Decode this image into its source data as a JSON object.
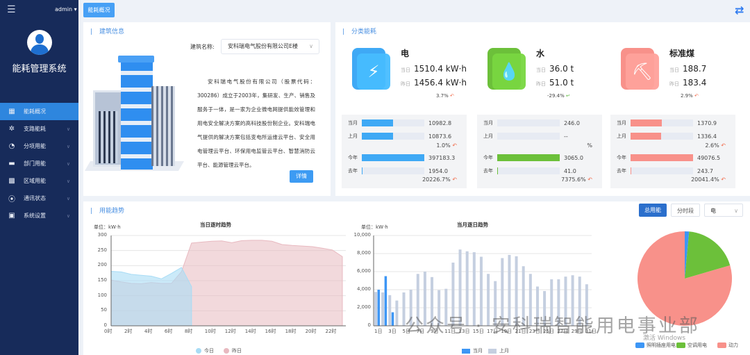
{
  "sidebar": {
    "user": "admin",
    "system_name": "能耗管理系统",
    "items": [
      {
        "label": "能耗概况",
        "icon": "building-icon"
      },
      {
        "label": "支路能耗",
        "icon": "network-icon"
      },
      {
        "label": "分项用能",
        "icon": "gauge-icon"
      },
      {
        "label": "部门用能",
        "icon": "folder-icon"
      },
      {
        "label": "区域用能",
        "icon": "grid-building-icon"
      },
      {
        "label": "通讯状态",
        "icon": "location-icon"
      },
      {
        "label": "系统设置",
        "icon": "settings-monitor-icon"
      }
    ]
  },
  "tabs": {
    "active": "能耗概况"
  },
  "building": {
    "title": "建筑信息",
    "select_label": "建筑名称:",
    "select_value": "安科瑞电气股份有限公司E楼",
    "description": "安科瑞电气股份有限公司（股票代码：300286）成立于2003年，集研发、生产、销售及服务于一体，是一家为企业微电网提供能效管理和用电安全解决方案的高科技股份制企业。安科瑞电气提供的解决方案包括变电所运维云平台、安全用电管理云平台、环保用电监管云平台、智慧消防云平台、能源管理云平台。",
    "detail_button": "详情"
  },
  "category": {
    "title": "分类能耗",
    "today_label": "当日",
    "yesterday_label": "昨日",
    "cards": [
      {
        "name": "电",
        "today": "1510.4 kW·h",
        "yesterday": "1456.4 kW·h",
        "change": "3.7%",
        "trend": "up",
        "color": "#3fa9f5",
        "month": {
          "cur_label": "当月",
          "cur": "10982.8",
          "cur_frac": 0.5,
          "prev_label": "上月",
          "prev": "10873.6",
          "prev_frac": 0.5,
          "change": "1.0%"
        },
        "year": {
          "cur_label": "今年",
          "cur": "397183.3",
          "cur_frac": 1.0,
          "prev_label": "去年",
          "prev": "1954.0",
          "prev_frac": 0.01,
          "change": "20226.7%"
        }
      },
      {
        "name": "水",
        "today": "36.0 t",
        "yesterday": "51.0 t",
        "change": "-29.4%",
        "trend": "down",
        "color": "#6cc03a",
        "month": {
          "cur_label": "当月",
          "cur": "246.0",
          "cur_frac": 0,
          "prev_label": "上月",
          "prev": "--",
          "prev_frac": 0,
          "change": "%"
        },
        "year": {
          "cur_label": "今年",
          "cur": "3065.0",
          "cur_frac": 1.0,
          "prev_label": "去年",
          "prev": "41.0",
          "prev_frac": 0.013,
          "change": "7375.6%"
        }
      },
      {
        "name": "标准煤",
        "today": "188.7",
        "yesterday": "183.4",
        "change": "2.9%",
        "trend": "up",
        "color": "#f8918a",
        "month": {
          "cur_label": "当月",
          "cur": "1370.9",
          "cur_frac": 0.5,
          "prev_label": "上月",
          "prev": "1336.4",
          "prev_frac": 0.49,
          "change": "2.6%"
        },
        "year": {
          "cur_label": "今年",
          "cur": "49076.5",
          "cur_frac": 1.0,
          "prev_label": "去年",
          "prev": "243.7",
          "prev_frac": 0.005,
          "change": "20041.4%"
        }
      }
    ]
  },
  "trend": {
    "title": "用能趋势",
    "buttons": [
      "总用能",
      "分时段"
    ],
    "energy_select": "电"
  },
  "chart_data": [
    {
      "type": "area",
      "title": "当日逐时趋势",
      "unit": "单位：kW·h",
      "ylim": [
        0,
        300
      ],
      "yticks": [
        0,
        50,
        100,
        150,
        200,
        250,
        300
      ],
      "x": [
        0,
        1,
        2,
        3,
        4,
        5,
        6,
        7,
        8,
        9,
        10,
        11,
        12,
        13,
        14,
        15,
        16,
        17,
        18,
        19,
        20,
        21,
        22,
        23
      ],
      "xticks": [
        "0时",
        "2时",
        "4时",
        "6时",
        "8时",
        "10时",
        "12时",
        "14时",
        "16时",
        "18时",
        "20时",
        "22时"
      ],
      "series": [
        {
          "name": "今日",
          "color": "#a8dcf5",
          "values": [
            181,
            179,
            171,
            168,
            165,
            156,
            174,
            194,
            130
          ]
        },
        {
          "name": "昨日",
          "color": "#e8b9c0",
          "values": [
            152,
            146,
            141,
            140,
            144,
            141,
            141,
            180,
            275,
            278,
            281,
            282,
            276,
            283,
            284,
            284,
            281,
            270,
            267,
            265,
            263,
            258,
            252,
            230
          ]
        }
      ]
    },
    {
      "type": "bar",
      "title": "当月逐日趋势",
      "unit": "单位：kW·h",
      "ylim": [
        0,
        10000
      ],
      "yticks": [
        "0",
        "2,000",
        "4,000",
        "6,000",
        "8,000",
        "10,000"
      ],
      "xticks": [
        "1日",
        "3日",
        "5日",
        "7日",
        "9日",
        "11日",
        "13日",
        "15日",
        "17日",
        "19日",
        "21日",
        "23日",
        "25日",
        "27日",
        "29日",
        "31日"
      ],
      "series": [
        {
          "name": "当月",
          "color": "#3d96f5",
          "values": [
            4000,
            5500,
            1500
          ]
        },
        {
          "name": "上月",
          "color": "#c5cfe0",
          "values": [
            3750,
            3700,
            3400,
            2800,
            3700,
            4000,
            5750,
            6000,
            5400,
            3950,
            4100,
            7000,
            8450,
            8250,
            8150,
            7650,
            5750,
            4950,
            7500,
            7850,
            7700,
            6600,
            5750,
            4350,
            3850,
            5150,
            5150,
            5450,
            5600,
            5450,
            4600
          ]
        }
      ]
    },
    {
      "type": "pie",
      "labels": [
        "照明插座用电",
        "空调用电",
        "动力"
      ],
      "values": [
        1.5,
        19,
        79.5
      ],
      "colors": [
        "#3d96f5",
        "#6cc03a",
        "#f8918a"
      ]
    }
  ],
  "overlay": {
    "watermark": "公众号 · 安科瑞智能用电事业部",
    "activation": "激活 Windows"
  }
}
